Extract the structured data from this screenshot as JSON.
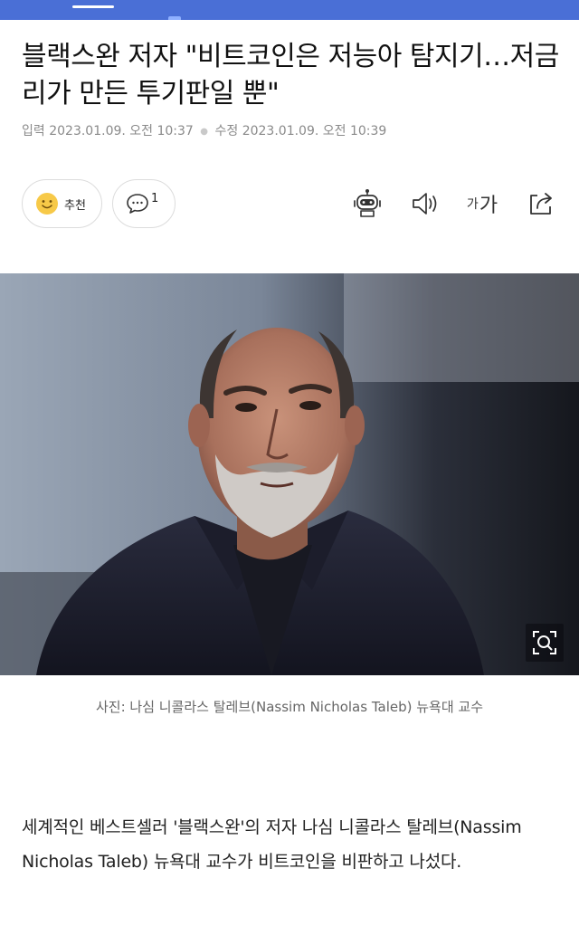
{
  "article": {
    "title": "블랙스완 저자 \"비트코인은 저능아 탐지기…저금리가 만든 투기판일 뿐\"",
    "published_label": "입력",
    "published": "2023.01.09. 오전 10:37",
    "modified_label": "수정",
    "modified": "2023.01.09. 오전 10:39",
    "photo_caption": "사진: 나심 니콜라스 탈레브(Nassim Nicholas Taleb) 뉴욕대 교수",
    "body": "세계적인 베스트셀러 '블랙스완'의 저자 나심 니콜라스 탈레브(Nassim Nicholas Taleb) 뉴욕대 교수가 비트코인을 비판하고 나섰다."
  },
  "actions": {
    "recommend_label": "추천",
    "comment_count": "1",
    "font_small": "가",
    "font_large": "가"
  },
  "icons": {
    "recommend": "smiley-icon",
    "comment": "speech-bubble-icon",
    "summary": "robot-icon",
    "tts": "speaker-icon",
    "font": "font-size-icon",
    "share": "share-icon",
    "zoom": "image-zoom-icon"
  },
  "colors": {
    "header": "#4a6fd6",
    "smiley": "#f7c948",
    "meta_text": "#8a8a8a"
  }
}
